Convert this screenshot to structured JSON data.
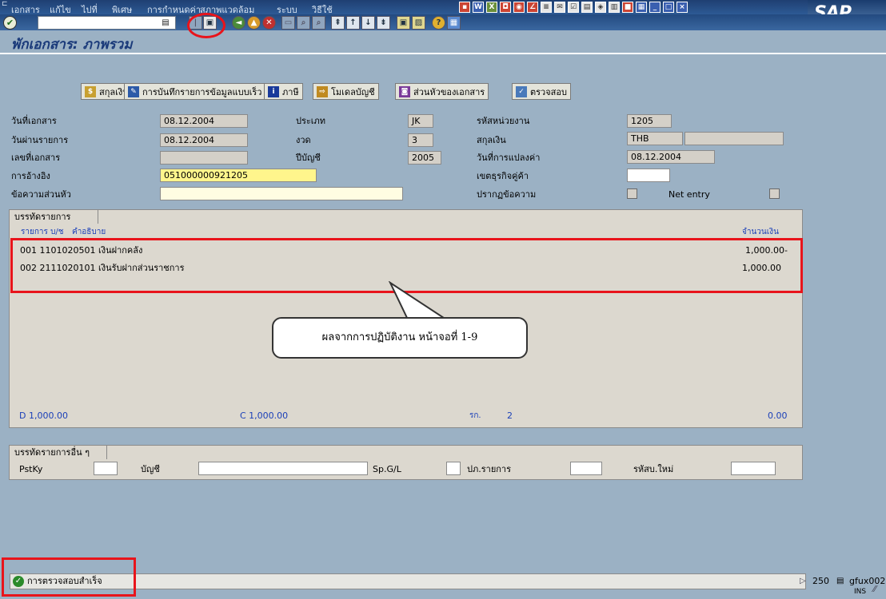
{
  "menu": {
    "items": [
      "เอกสาร",
      "แก้ไข",
      "ไปที่",
      "พิเศษ",
      "การกำหนดค่า",
      "สภาพแวดล้อม",
      "ระบบ",
      "วิธีใช้"
    ]
  },
  "logo": "SAP",
  "command": {
    "value": ""
  },
  "icons": [
    "enter-icon",
    "save-icon",
    "back-icon",
    "exit-icon",
    "cancel-icon",
    "print-icon",
    "find-icon",
    "find-next-icon",
    "first-page-icon",
    "prev-page-icon",
    "next-page-icon",
    "last-page-icon",
    "new-session-icon",
    "shortcut-icon",
    "help-icon",
    "layout-icon"
  ],
  "title": "พักเอกสาร: ภาพรวม",
  "app_toolbar": {
    "currency": "สกุลเงิน",
    "fast_entry": "การบันทึกรายการข้อมูลแบบเร็ว",
    "tax": "ภาษี",
    "account_model": "โมเดลบัญชี",
    "doc_header": "ส่วนหัวของเอกสาร",
    "check": "ตรวจสอบ"
  },
  "header": {
    "doc_date_label": "วันที่เอกสาร",
    "doc_date": "08.12.2004",
    "posting_date_label": "วันผ่านรายการ",
    "posting_date": "08.12.2004",
    "doc_no_label": "เลขที่เอกสาร",
    "doc_no": "",
    "reference_label": "การอ้างอิง",
    "reference": "051000000921205",
    "header_text_label": "ข้อความส่วนหัว",
    "header_text": "",
    "type_label": "ประเภท",
    "type": "JK",
    "period_label": "งวด",
    "period": "3",
    "fiscal_year_label": "ปีบัญชี",
    "fiscal_year": "2005",
    "company_code_label": "รหัสหน่วยงาน",
    "company_code": "1205",
    "currency_label": "สกุลเงิน",
    "currency": "THB",
    "currency2": "",
    "translation_date_label": "วันที่การแปลงค่า",
    "translation_date": "08.12.2004",
    "trading_partner_label": "เขตธุรกิจคู่ค้า",
    "trading_partner": "",
    "display_text_label": "ปรากฏข้อความ",
    "net_entry_label": "Net entry"
  },
  "line_items": {
    "tab": "บรรทัดรายการ",
    "col_item": "รายการ บ/ช",
    "col_desc": "คำอธิบาย",
    "col_amount": "จำนวนเงิน",
    "rows": [
      {
        "text": "001 1101020501 เงินฝากคลัง",
        "amount": "1,000.00-"
      },
      {
        "text": "002 2111020101 เงินรับฝากส่วนราชการ",
        "amount": "1,000.00"
      }
    ],
    "debit": "D  1,000.00",
    "credit": "C  1,000.00",
    "count_label": "รก.",
    "count": "2",
    "balance": "0.00"
  },
  "callout": "ผลจากการปฏิบัติงาน หน้าจอที่ 1-9",
  "other_items": {
    "tab": "บรรทัดรายการอื่น ๆ",
    "pstky_label": "PstKy",
    "account_label": "บัญชี",
    "spgl_label": "Sp.G/L",
    "trans_label": "ปภ.รายการ",
    "new_code_label": "รหัสบ.ใหม่"
  },
  "status": {
    "message": "การตรวจสอบสำเร็จ",
    "client": "250",
    "server": "gfux002",
    "mode": "INS"
  },
  "colors": {
    "highlight": "#e8141b",
    "title": "#1a3a7a",
    "link": "#1a3fb8"
  }
}
